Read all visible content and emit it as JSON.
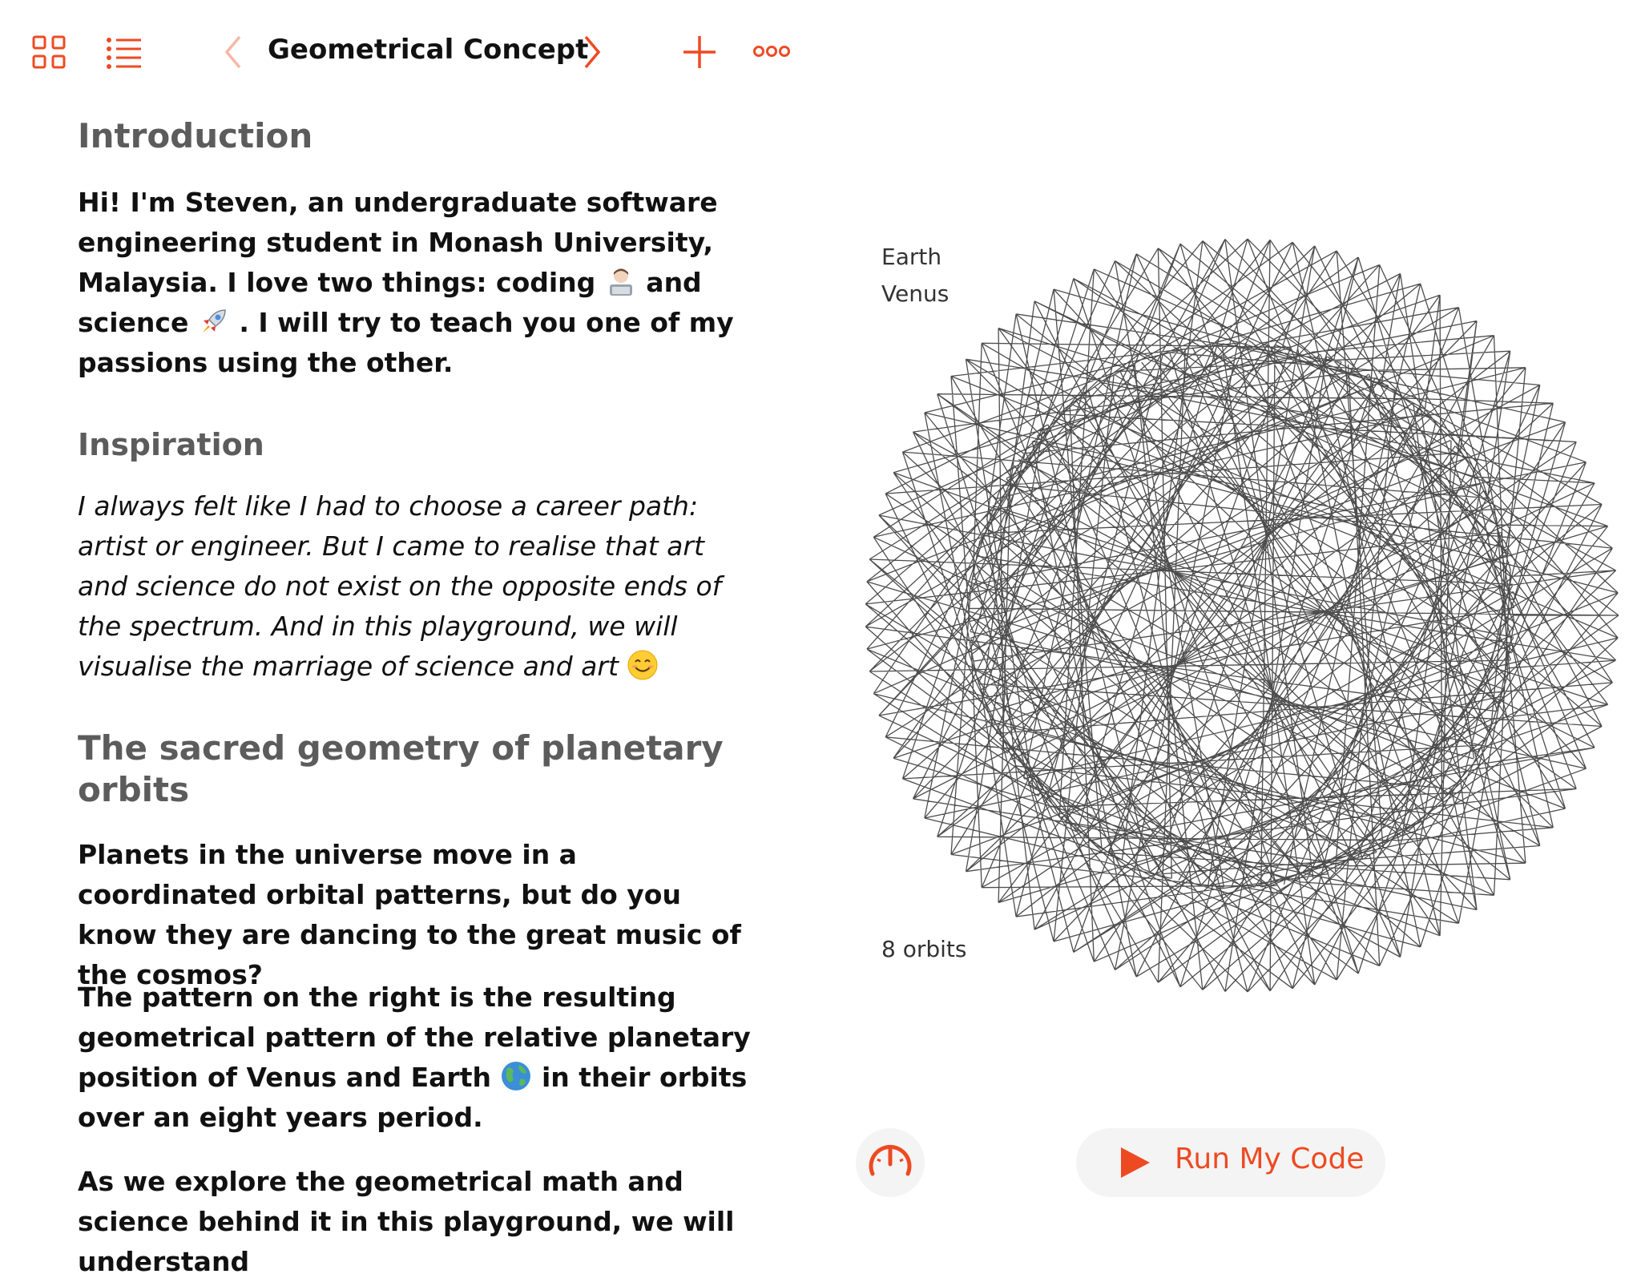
{
  "toolbar": {
    "title": "Geometrical Concept",
    "icons": [
      "grid-icon",
      "list-icon",
      "chevron-left-icon",
      "chevron-right-icon",
      "plus-icon",
      "more-icon"
    ],
    "accent": "#ee4a22"
  },
  "content": {
    "intro_heading": "Introduction",
    "intro_text_1": "Hi! I'm Steven, an undergraduate software engineering student in Monash University, Malaysia. I love two things: coding",
    "intro_text_2": "and science",
    "intro_text_3": ". I will try to teach you one of my passions using the other.",
    "inspiration_heading": "Inspiration",
    "inspiration_text": "I always felt like I had to choose a career path: artist or engineer. But I came to realise that art and science do not exist on the opposite ends of the spectrum. And in this playground, we will visualise the marriage of science and art",
    "sacred_heading": "The sacred geometry of planetary orbits",
    "para_1": "Planets in the universe move in a coordinated orbital patterns, but do you know they are dancing to the great music of the cosmos?",
    "para_2a": "The pattern on the right is the resulting geometrical pattern of the relative planetary position of Venus and Earth",
    "para_2b": "in their orbits over an eight years period.",
    "para_3": "As we explore the geometrical math and science behind it in this playground, we will understand"
  },
  "visualization": {
    "label_planet_1": "Earth",
    "label_planet_2": "Venus",
    "label_orbits": "8 orbits"
  },
  "controls": {
    "run_label": "Run My Code",
    "speed_icon": "speedometer-icon",
    "run_icon": "play-icon"
  }
}
